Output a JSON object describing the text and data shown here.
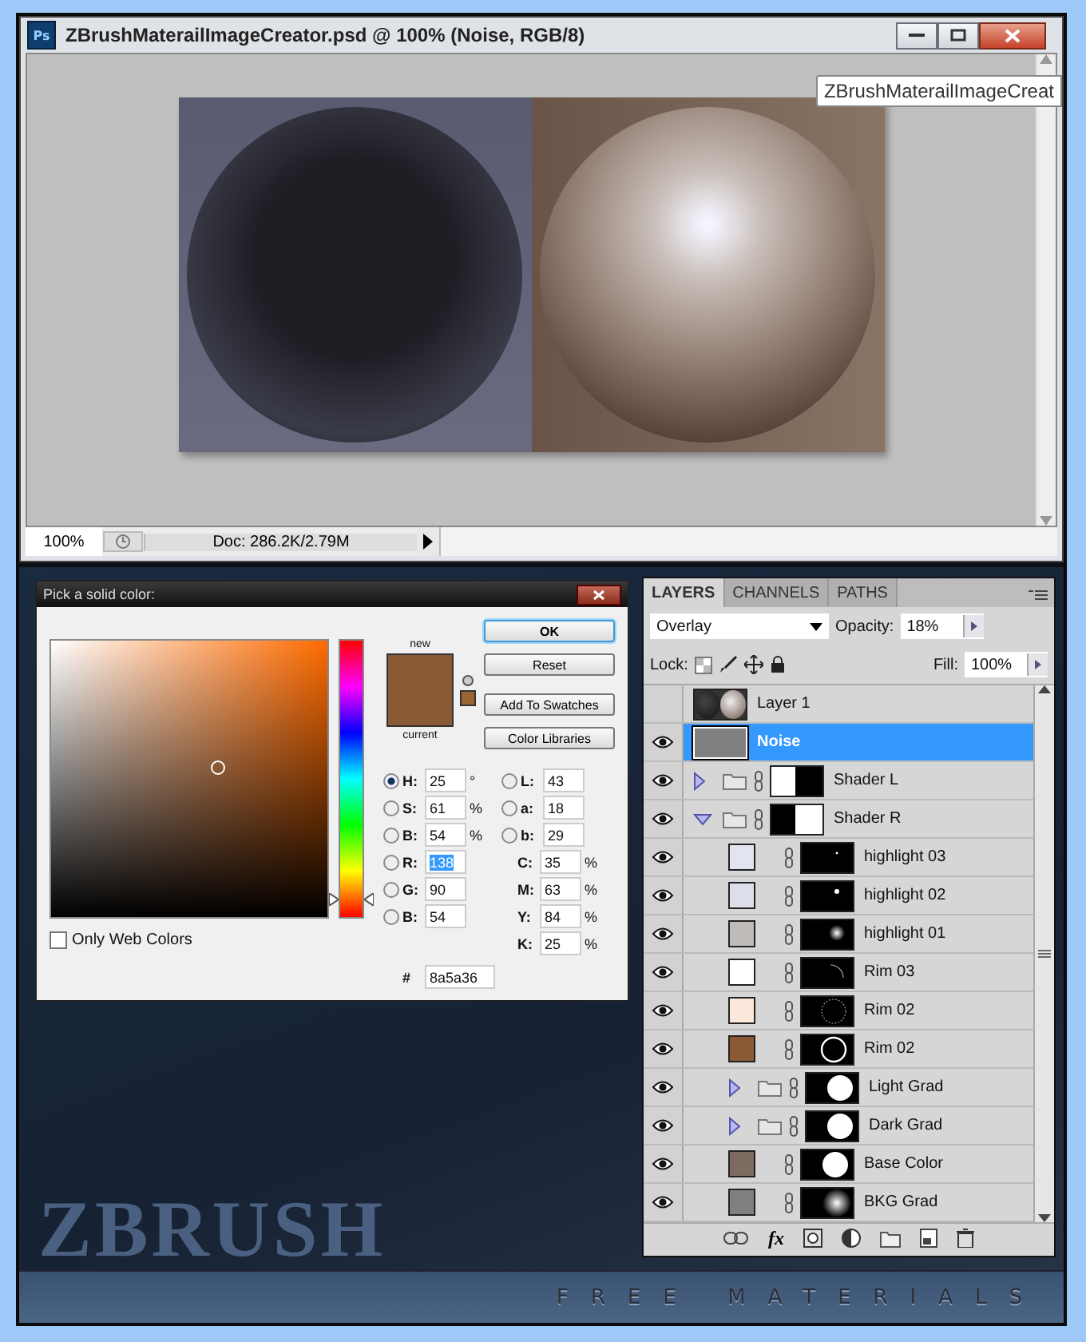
{
  "window": {
    "app_icon": "Ps",
    "title": "ZBrushMaterailImageCreator.psd @ 100% (Noise, RGB/8)",
    "tooltip": "ZBrushMaterailImageCreat"
  },
  "status_bar": {
    "zoom": "100%",
    "doc": "Doc: 286.2K/2.79M"
  },
  "color_picker": {
    "title": "Pick a solid color:",
    "new_label": "new",
    "current_label": "current",
    "hue_slider": {
      "level": 0.07
    },
    "buttons": [
      {
        "label": "OK",
        "default": true
      },
      {
        "label": "Reset",
        "default": false
      },
      {
        "label": "Add To Swatches",
        "default": false
      },
      {
        "label": "Color Libraries",
        "default": false
      }
    ],
    "hsb_rgb": [
      {
        "label": "H:",
        "value": "25",
        "unit": "°",
        "selected": true,
        "highlighted": false
      },
      {
        "label": "S:",
        "value": "61",
        "unit": "%",
        "selected": false,
        "highlighted": false
      },
      {
        "label": "B:",
        "value": "54",
        "unit": "%",
        "selected": false,
        "highlighted": false
      },
      {
        "label": "R:",
        "value": "138",
        "selected": false,
        "highlighted": true
      },
      {
        "label": "G:",
        "value": "90",
        "selected": false,
        "highlighted": false
      },
      {
        "label": "B:",
        "value": "54",
        "selected": false,
        "highlighted": false
      }
    ],
    "lab": [
      {
        "label": "L:",
        "value": "43",
        "selected": false
      },
      {
        "label": "a:",
        "value": "18",
        "selected": false
      },
      {
        "label": "b:",
        "value": "29",
        "selected": false
      }
    ],
    "cmyk": [
      {
        "label": "C:",
        "value": "35",
        "unit": "%"
      },
      {
        "label": "M:",
        "value": "63",
        "unit": "%"
      },
      {
        "label": "Y:",
        "value": "84",
        "unit": "%"
      },
      {
        "label": "K:",
        "value": "25",
        "unit": "%"
      }
    ],
    "hex": {
      "label": "#",
      "value": "8a5a36"
    },
    "only_web_colors": {
      "label": "Only Web Colors",
      "checked": false
    }
  },
  "layers_panel": {
    "tabs": [
      {
        "label": "LAYERS",
        "selected": true
      },
      {
        "label": "CHANNELS",
        "selected": false
      },
      {
        "label": "PATHS",
        "selected": false
      }
    ],
    "blend_mode": "Overlay",
    "opacity_label": "Opacity:",
    "opacity": "18%",
    "lock_label": "Lock:",
    "fill_label": "Fill:",
    "fill": "100%",
    "effects_label": "fx",
    "layers": [
      {
        "name": "Layer 1",
        "kind": "image",
        "visible": false,
        "selected": false
      },
      {
        "name": "Noise",
        "kind": "fill",
        "color": "#808080",
        "visible": true,
        "selected": true
      },
      {
        "name": "Shader L",
        "kind": "group",
        "mask": {
          "kind": "half-left"
        },
        "visible": true,
        "selected": false,
        "expanded": false
      },
      {
        "name": "Shader R",
        "kind": "group",
        "mask": {
          "kind": "half-right"
        },
        "visible": true,
        "selected": false,
        "expanded": true,
        "children": [
          {
            "name": "highlight 03",
            "kind": "fill",
            "color": "#e2e5f0",
            "mask": {
              "kind": "dot-small"
            },
            "visible": true,
            "selected": false
          },
          {
            "name": "highlight 02",
            "kind": "fill",
            "color": "#dcdfea",
            "mask": {
              "kind": "dot"
            },
            "visible": true,
            "selected": false
          },
          {
            "name": "highlight 01",
            "kind": "fill",
            "color": "#bfbbb9",
            "mask": {
              "kind": "glow"
            },
            "visible": true,
            "selected": false
          },
          {
            "name": "Rim 03",
            "kind": "fill",
            "color": "#ffffff",
            "mask": {
              "kind": "arc"
            },
            "visible": true,
            "selected": false
          },
          {
            "name": "Rim 02",
            "kind": "fill",
            "color": "#fde9dc",
            "mask": {
              "kind": "ring-faint"
            },
            "visible": true,
            "selected": false
          },
          {
            "name": "Rim 02",
            "kind": "fill",
            "color": "#8a5a36",
            "mask": {
              "kind": "ring"
            },
            "visible": true,
            "selected": false
          },
          {
            "name": "Light Grad",
            "kind": "group",
            "mask": {
              "kind": "disc"
            },
            "visible": true,
            "selected": false,
            "expanded": false
          },
          {
            "name": "Dark Grad",
            "kind": "group",
            "mask": {
              "kind": "disc"
            },
            "visible": true,
            "selected": false,
            "expanded": false
          },
          {
            "name": "Base Color",
            "kind": "fill",
            "color": "#7d6b62",
            "mask": {
              "kind": "disc"
            },
            "visible": true,
            "selected": false
          },
          {
            "name": "BKG Grad",
            "kind": "fill",
            "color": "#808080",
            "mask": {
              "kind": "glow-large"
            },
            "visible": true,
            "selected": false
          }
        ]
      }
    ]
  },
  "background": {
    "logo": "ZBRUSH",
    "banner": "FREE MATERIALS"
  }
}
